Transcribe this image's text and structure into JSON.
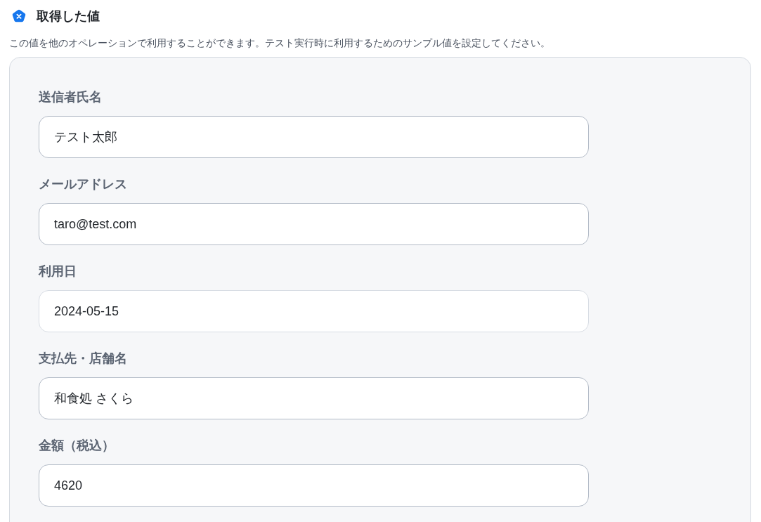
{
  "header": {
    "title": "取得した値",
    "description": "この値を他のオペレーションで利用することができます。テスト実行時に利用するためのサンプル値を設定してください。"
  },
  "fields": [
    {
      "label": "送信者氏名",
      "value": "テスト太郎",
      "kind": "text"
    },
    {
      "label": "メールアドレス",
      "value": "taro@test.com",
      "kind": "text"
    },
    {
      "label": "利用日",
      "value": "2024-05-15",
      "kind": "date"
    },
    {
      "label": "支払先・店舗名",
      "value": "和食処 さくら",
      "kind": "text"
    },
    {
      "label": "金額（税込）",
      "value": "4620",
      "kind": "text"
    }
  ]
}
